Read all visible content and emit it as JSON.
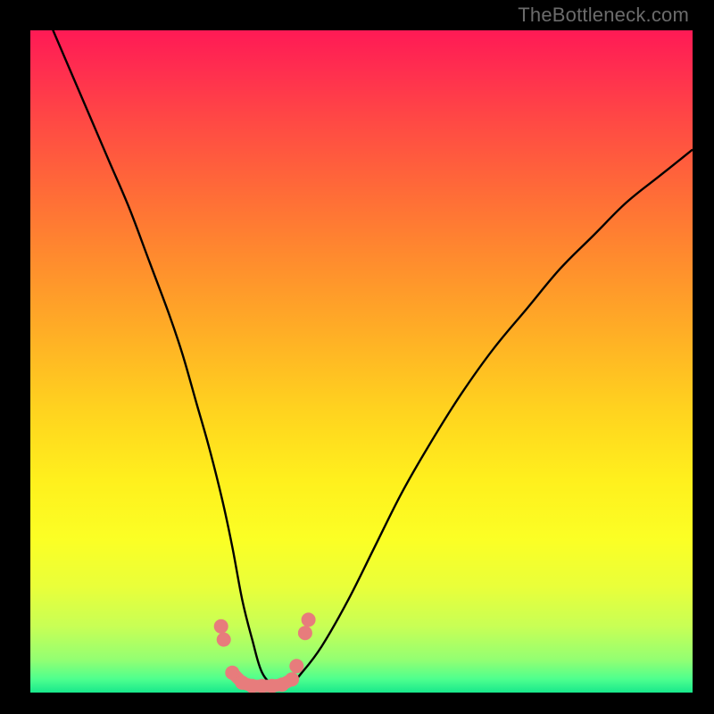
{
  "watermark": "TheBottleneck.com",
  "colors": {
    "frame": "#000000",
    "curve": "#000000",
    "marker": "#e77c7c"
  },
  "chart_data": {
    "type": "line",
    "title": "",
    "xlabel": "",
    "ylabel": "",
    "xlim": [
      0,
      100
    ],
    "ylim": [
      0,
      100
    ],
    "grid": false,
    "legend": false,
    "series": [
      {
        "name": "bottleneck-curve",
        "x": [
          0,
          3,
          6,
          9,
          12,
          15,
          18,
          21,
          23,
          25,
          27,
          29,
          30.5,
          32,
          33.5,
          35,
          37,
          39,
          41,
          44,
          48,
          52,
          56,
          60,
          65,
          70,
          75,
          80,
          85,
          90,
          95,
          100
        ],
        "y": [
          108,
          101,
          94,
          87,
          80,
          73,
          65,
          57,
          51,
          44,
          37,
          29,
          22,
          14,
          8,
          3,
          1,
          1,
          3,
          7,
          14,
          22,
          30,
          37,
          45,
          52,
          58,
          64,
          69,
          74,
          78,
          82
        ]
      }
    ],
    "markers": {
      "name": "highlighted-points",
      "x": [
        28.8,
        29.2,
        30.5,
        32.0,
        33.5,
        35.0,
        36.5,
        38.0,
        39.5,
        40.2,
        41.5,
        42.0
      ],
      "y": [
        10.0,
        8.0,
        3.0,
        1.5,
        1.0,
        1.0,
        1.0,
        1.2,
        2.0,
        4.0,
        9.0,
        11.0
      ]
    }
  }
}
